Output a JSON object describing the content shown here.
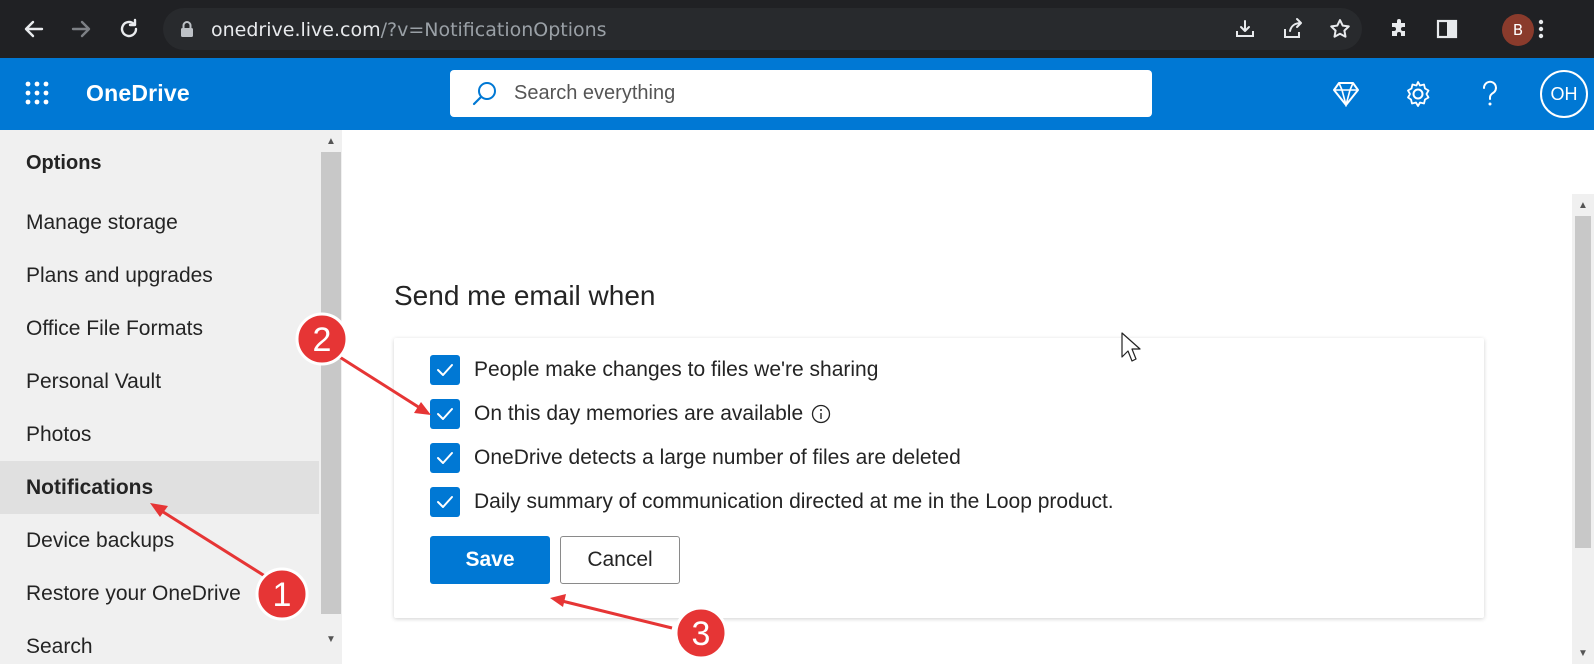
{
  "browser": {
    "url_host": "onedrive.live.com",
    "url_path": "/?v=NotificationOptions",
    "profile_initial": "B"
  },
  "header": {
    "brand": "OneDrive",
    "search_placeholder": "Search everything",
    "user_initials": "OH",
    "accent_color": "#0078d4"
  },
  "sidebar": {
    "title": "Options",
    "items": [
      {
        "label": "Manage storage"
      },
      {
        "label": "Plans and upgrades"
      },
      {
        "label": "Office File Formats"
      },
      {
        "label": "Personal Vault"
      },
      {
        "label": "Photos"
      },
      {
        "label": "Notifications"
      },
      {
        "label": "Device backups"
      },
      {
        "label": "Restore your OneDrive"
      },
      {
        "label": "Search"
      }
    ],
    "active_index": 5
  },
  "main": {
    "section_title": "Send me email when",
    "options": [
      {
        "label": "People make changes to files we're sharing",
        "checked": true
      },
      {
        "label": "On this day memories are available",
        "checked": true
      },
      {
        "label": "OneDrive detects a large number of files are deleted",
        "checked": true
      },
      {
        "label": "Daily summary of communication directed at me in the Loop product.",
        "checked": true
      }
    ],
    "save_label": "Save",
    "cancel_label": "Cancel"
  },
  "annotations": {
    "step1": "1",
    "step2": "2",
    "step3": "3",
    "color": "#e63535"
  }
}
